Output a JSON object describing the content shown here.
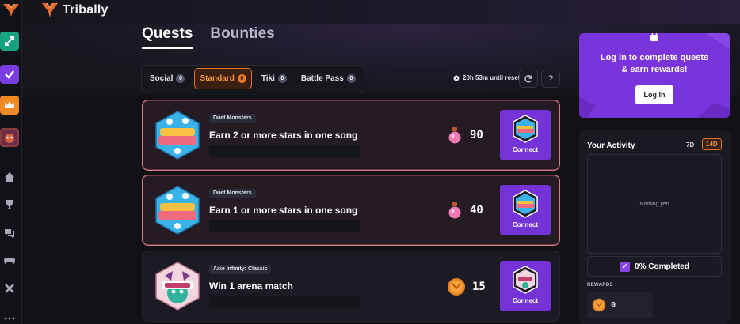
{
  "brand": {
    "name": "Tribally"
  },
  "tabs": [
    {
      "label": "Quests",
      "active": true
    },
    {
      "label": "Bounties",
      "active": false
    }
  ],
  "subtabs": [
    {
      "label": "Social",
      "count": "0",
      "active": false
    },
    {
      "label": "Standard",
      "count": "0",
      "active": true
    },
    {
      "label": "Tiki",
      "count": "0",
      "active": false
    },
    {
      "label": "Battle Pass",
      "count": "0",
      "active": false
    }
  ],
  "reset": {
    "text": "20h 53m until reset"
  },
  "toolbar": {
    "help": "?"
  },
  "quests": [
    {
      "game": "Duet Monsters",
      "title": "Earn 2 or more stars in one song",
      "reward": "90",
      "reward_icon": "potion-icon",
      "button": "Connect"
    },
    {
      "game": "Duet Monsters",
      "title": "Earn 1 or more stars in one song",
      "reward": "40",
      "reward_icon": "potion-icon",
      "button": "Connect"
    },
    {
      "game": "Axie Infinity: Classic",
      "title": "Win 1 arena match",
      "reward": "15",
      "reward_icon": "coin-icon",
      "button": "Connect"
    }
  ],
  "login_panel": {
    "line1": "Log in to complete quests",
    "line2": "& earn rewards!",
    "button": "Log In"
  },
  "activity": {
    "title": "Your Activity",
    "range_7d": "7D",
    "range_14d": "14D",
    "empty_text": "Nothing yet!",
    "completed": "0% Completed",
    "rewards_label": "REWARDS",
    "rewards_value": "0"
  },
  "colors": {
    "accent_purple": "#7a34dc",
    "accent_orange": "#e0712a",
    "highlight_border": "#d67f86"
  }
}
